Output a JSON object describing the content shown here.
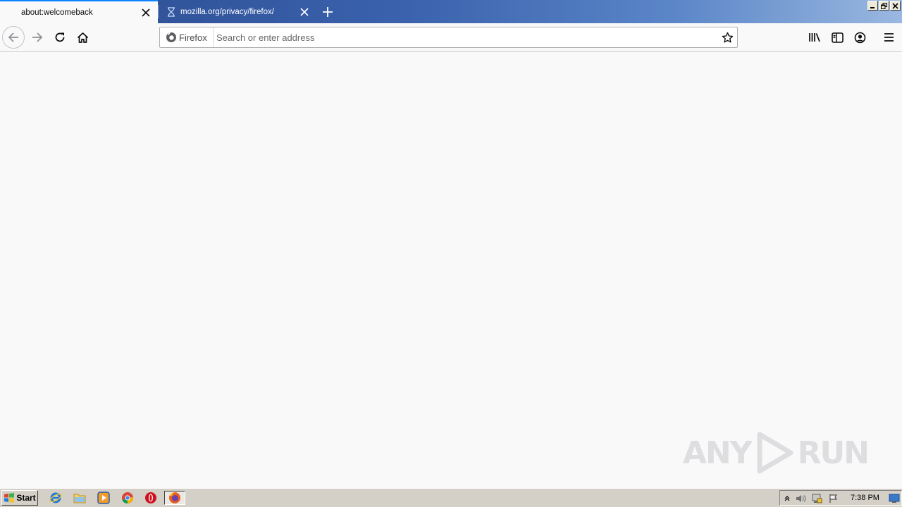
{
  "tabs": [
    {
      "title": "about:welcomeback",
      "active": true
    },
    {
      "title": "mozilla.org/privacy/firefox/",
      "active": false
    }
  ],
  "toolbar": {
    "identity_label": "Firefox",
    "address_placeholder": "Search or enter address",
    "address_value": ""
  },
  "taskbar": {
    "start_label": "Start",
    "clock": "7:38 PM",
    "pinned_icons": [
      "internet-explorer-icon",
      "file-explorer-icon",
      "media-player-icon",
      "chrome-icon",
      "opera-icon",
      "firefox-icon"
    ]
  },
  "watermark": {
    "text_left": "ANY",
    "text_right": "RUN"
  },
  "colors": {
    "tab_accent": "#0a84ff",
    "tabstrip_start": "#2b4b8f",
    "tabstrip_end": "#9ab8e0",
    "toolbar_bg": "#f9f9fa",
    "taskbar_bg": "#d4d0c8"
  }
}
